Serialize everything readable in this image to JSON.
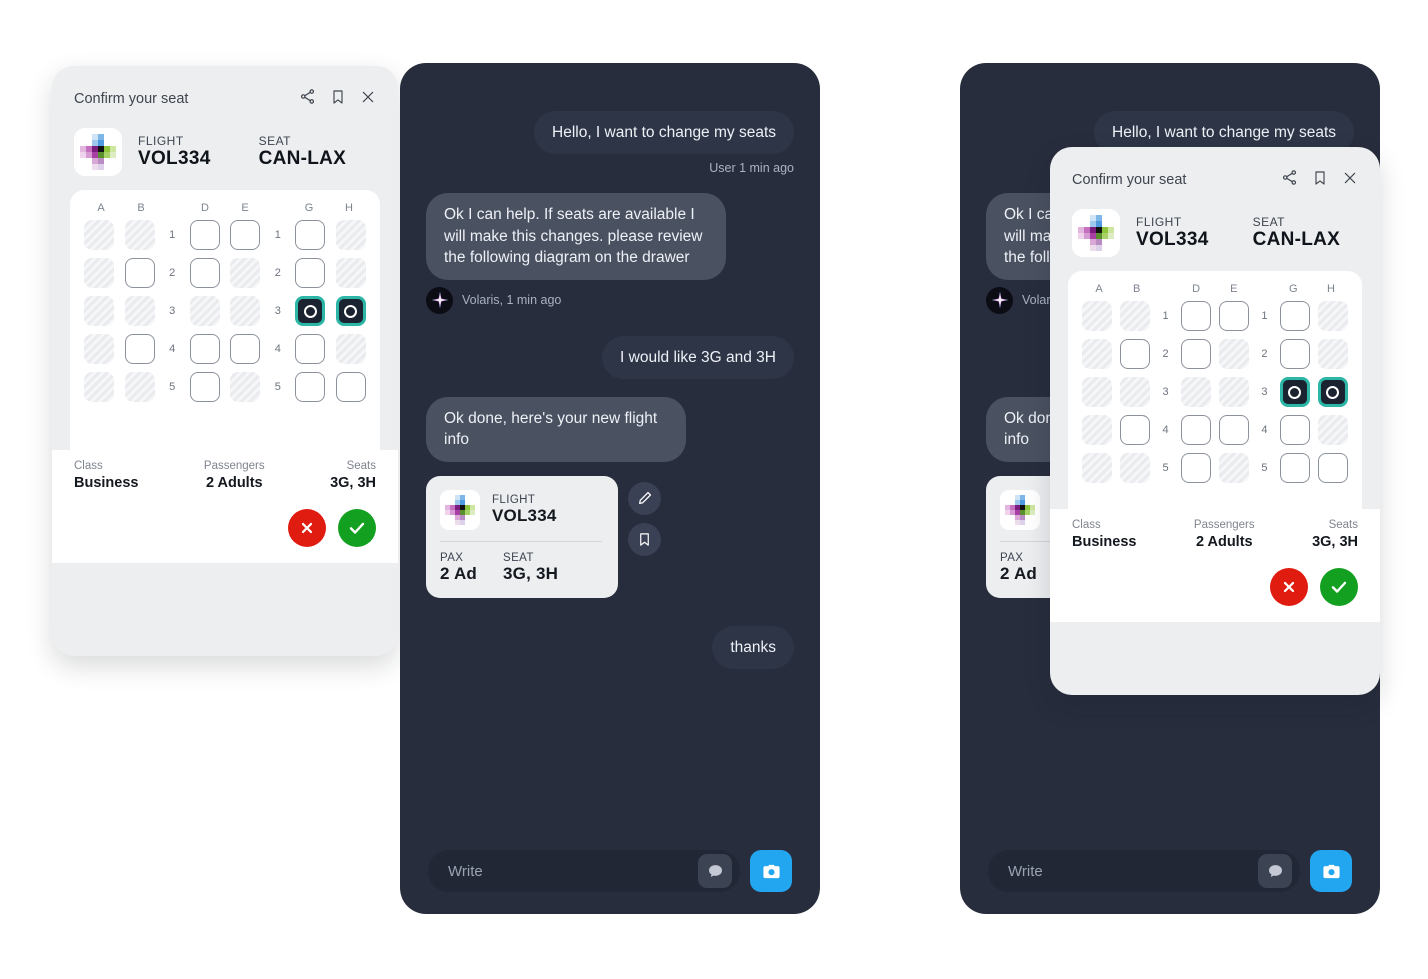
{
  "brand": {
    "name": "Volaris",
    "logo_icon": "volaris-pixel-cross-logo"
  },
  "seat_card": {
    "title": "Confirm your seat",
    "icons": {
      "share": "share-icon",
      "bookmark": "bookmark-icon",
      "close": "close-icon"
    },
    "flight_label": "FLIGHT",
    "flight_value": "VOL334",
    "seat_label": "SEAT",
    "seat_value": "CAN-LAX",
    "columns": [
      "A",
      "B",
      "D",
      "E",
      "G",
      "H"
    ],
    "rows": [
      {
        "number": "1",
        "seats": [
          "occupied",
          "occupied",
          "free",
          "free",
          "free",
          "occupied"
        ]
      },
      {
        "number": "2",
        "seats": [
          "occupied",
          "free",
          "free",
          "occupied",
          "free",
          "occupied"
        ]
      },
      {
        "number": "3",
        "seats": [
          "occupied",
          "occupied",
          "occupied",
          "occupied",
          "selected",
          "selected"
        ]
      },
      {
        "number": "4",
        "seats": [
          "occupied",
          "free",
          "free",
          "free",
          "free",
          "occupied"
        ]
      },
      {
        "number": "5",
        "seats": [
          "occupied",
          "occupied",
          "free",
          "occupied",
          "free",
          "free"
        ]
      }
    ],
    "footer": {
      "class_label": "Class",
      "class_value": "Business",
      "passengers_label": "Passengers",
      "passengers_value": "2 Adults",
      "seats_label": "Seats",
      "seats_value": "3G, 3H",
      "cancel_icon": "cancel-x-icon",
      "confirm_icon": "confirm-check-icon"
    },
    "colors": {
      "selected_seat_border": "#2cb6a6",
      "selected_seat_fill": "#1b2230",
      "cancel": "#e01b10",
      "confirm": "#13a021"
    }
  },
  "chat": {
    "messages": [
      {
        "side": "right",
        "sender": "user",
        "text": "Hello, I want to change my seats",
        "meta": "User 1 min ago"
      },
      {
        "side": "left",
        "sender": "bot",
        "text": "Ok I can help. If seats are available I will make this changes. please review the following diagram on the drawer",
        "meta": "Volaris, 1 min ago"
      },
      {
        "side": "right",
        "sender": "user",
        "text": "I would like 3G and 3H",
        "meta": ""
      },
      {
        "side": "left",
        "sender": "bot",
        "text": "Ok done, here's your new flight info",
        "meta": ""
      },
      {
        "side": "right",
        "sender": "user",
        "text": "thanks",
        "meta": ""
      }
    ],
    "flight_card": {
      "flight_label": "FLIGHT",
      "flight_value": "VOL334",
      "pax_label": "PAX",
      "pax_value": "2 Ad",
      "seat_label": "SEAT",
      "seat_value": "3G, 3H",
      "edit_icon": "edit-pencil-icon",
      "bookmark_icon": "bookmark-icon"
    },
    "input": {
      "placeholder": "Write",
      "emoji_icon": "chat-bubble-icon",
      "camera_icon": "camera-icon",
      "camera_color": "#23a6f0"
    }
  }
}
